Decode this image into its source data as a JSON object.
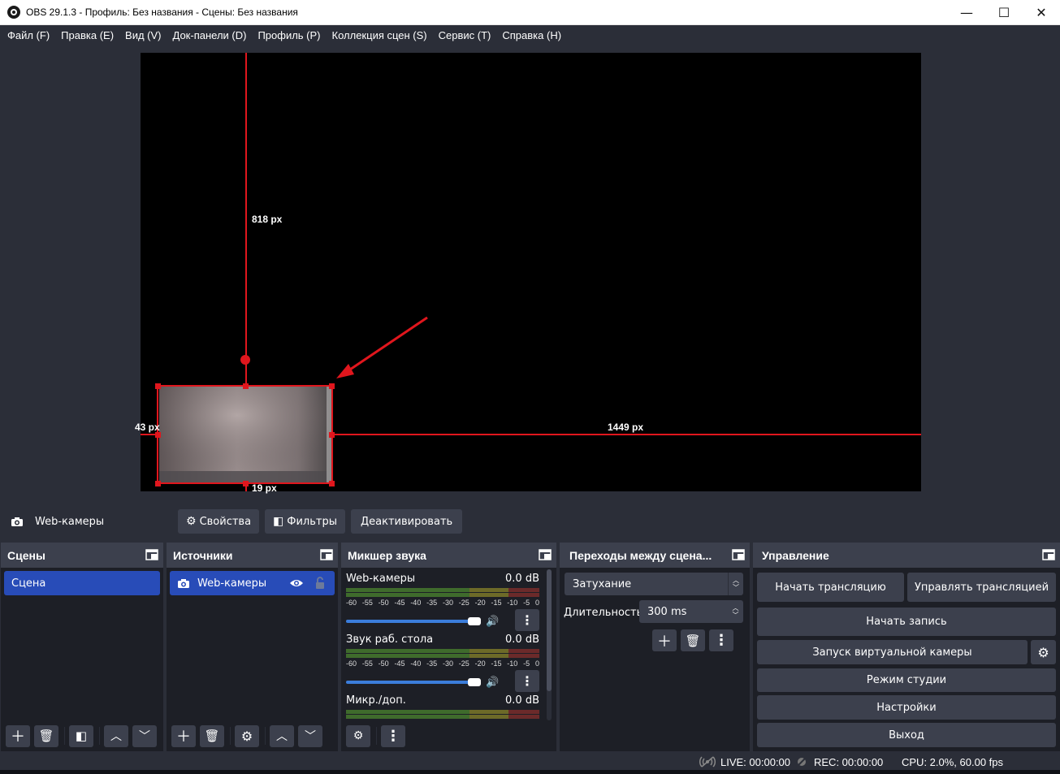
{
  "window": {
    "title": "OBS 29.1.3 - Профиль: Без названия - Сцены: Без названия",
    "minimize_glyph": "—",
    "maximize_glyph": "☐",
    "close_glyph": "✕"
  },
  "menu": [
    "Файл (F)",
    "Правка (E)",
    "Вид (V)",
    "Док-панели (D)",
    "Профиль (P)",
    "Коллекция сцен (S)",
    "Сервис (T)",
    "Справка (H)"
  ],
  "preview": {
    "measure_top": "818 px",
    "measure_left": "43 px",
    "measure_right": "1449 px",
    "measure_bottom": "19 px",
    "colors": {
      "canvas": "#000000",
      "selection": "#e0161d",
      "arrow": "#e0161d"
    }
  },
  "source_toolbar": {
    "source_icon": "camera-icon",
    "source_name": "Web-камеры",
    "properties_label": "Свойства",
    "filters_label": "Фильтры",
    "deactivate_label": "Деактивировать"
  },
  "scenes": {
    "header": "Сцены",
    "items": [
      {
        "label": "Сцена",
        "selected": true
      }
    ]
  },
  "sources": {
    "header": "Источники",
    "items": [
      {
        "label": "Web-камеры",
        "icon": "camera-icon",
        "visible": true,
        "locked": false
      }
    ]
  },
  "mixer": {
    "header": "Микшер звука",
    "scale": [
      "-60",
      "-55",
      "-50",
      "-45",
      "-40",
      "-35",
      "-30",
      "-25",
      "-20",
      "-15",
      "-10",
      "-5",
      "0"
    ],
    "tracks": [
      {
        "name": "Web-камеры",
        "level": "0.0 dB"
      },
      {
        "name": "Звук раб. стола",
        "level": "0.0 dB"
      },
      {
        "name": "Микр./доп.",
        "level": "0.0 dB"
      }
    ]
  },
  "transitions": {
    "header": "Переходы между сцена...",
    "selected": "Затухание",
    "duration_label": "Длительность",
    "duration_value": "300 ms"
  },
  "controls": {
    "header": "Управление",
    "start_stream": "Начать трансляцию",
    "manage_stream": "Управлять трансляцией",
    "start_recording": "Начать запись",
    "virtual_camera": "Запуск виртуальной камеры",
    "studio_mode": "Режим студии",
    "settings": "Настройки",
    "exit": "Выход"
  },
  "status": {
    "live": "LIVE: 00:00:00",
    "rec": "REC: 00:00:00",
    "cpu": "CPU: 2.0%, 60.00 fps"
  },
  "colors": {
    "bg": "#2b2e38",
    "dock_bg": "#1d1f26",
    "button": "#3c404d",
    "selection": "#284cb8",
    "volume_slider": "#3b7ddb"
  }
}
